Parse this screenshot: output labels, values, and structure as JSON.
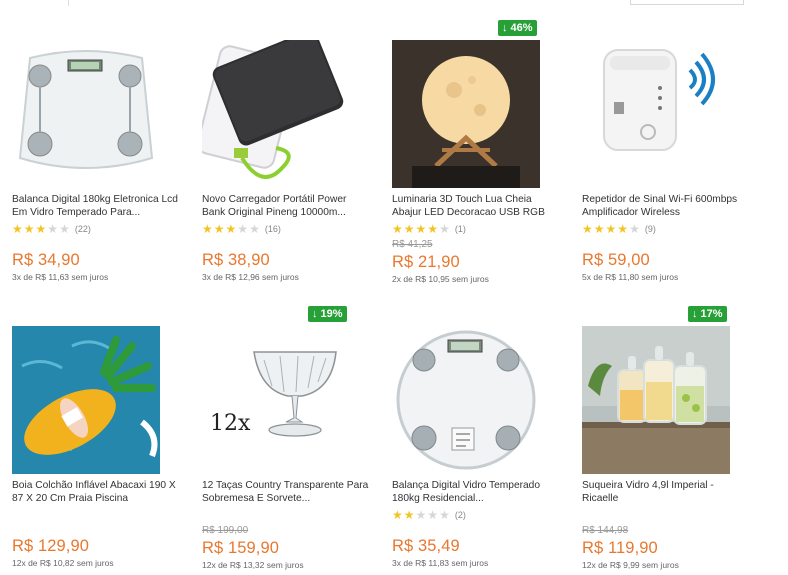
{
  "products": [
    {
      "title": "Balanca Digital 180kg Eletronica Lcd Em Vidro Temperado Para...",
      "stars": 3,
      "rating_count": "(22)",
      "old_price": "",
      "price": "R$ 34,90",
      "installments": "3x de R$ 11,63 sem juros",
      "badge": ""
    },
    {
      "title": "Novo Carregador Portátil Power Bank Original Pineng 10000m...",
      "stars": 3,
      "rating_count": "(16)",
      "old_price": "",
      "price": "R$ 38,90",
      "installments": "3x de R$ 12,96 sem juros",
      "badge": ""
    },
    {
      "title": "Luminaria 3D Touch Lua Cheia Abajur LED Decoracao USB RGB",
      "stars": 4,
      "rating_count": "(1)",
      "old_price": "R$ 41,25",
      "price": "R$ 21,90",
      "installments": "2x de R$ 10,95 sem juros",
      "badge": "↓ 46%"
    },
    {
      "title": "Repetidor de Sinal Wi-Fi 600mbps Amplificador Wireless",
      "stars": 4,
      "rating_count": "(9)",
      "old_price": "",
      "price": "R$ 59,00",
      "installments": "5x de R$ 11,80 sem juros",
      "badge": ""
    },
    {
      "title": "Boia Colchão Inflável Abacaxi 190 X 87 X 20 Cm Praia Piscina",
      "stars": 0,
      "rating_count": "",
      "old_price": "",
      "price": "R$ 129,90",
      "installments": "12x de R$ 10,82 sem juros",
      "badge": ""
    },
    {
      "title": "12 Taças Country Transparente Para Sobremesa E Sorvete...",
      "stars": 0,
      "rating_count": "",
      "old_price": "R$ 199,00",
      "price": "R$ 159,90",
      "installments": "12x de R$ 13,32 sem juros",
      "badge": "↓ 19%"
    },
    {
      "title": "Balança Digital Vidro Temperado 180kg Residencial...",
      "stars": 2,
      "rating_count": "(2)",
      "old_price": "",
      "price": "R$ 35,49",
      "installments": "3x de R$ 11,83 sem juros",
      "badge": ""
    },
    {
      "title": "Suqueira Vidro 4,9l Imperial - Ricaelle",
      "stars": 0,
      "rating_count": "",
      "old_price": "R$ 144,98",
      "price": "R$ 119,90",
      "installments": "12x de R$ 9,99 sem juros",
      "badge": "↓ 17%"
    }
  ],
  "image_text": {
    "glasses_count": "12x"
  },
  "colors": {
    "price": "#e8782f",
    "badge": "#26a037",
    "star_on": "#f2c526",
    "star_off": "#d6d6d6"
  }
}
